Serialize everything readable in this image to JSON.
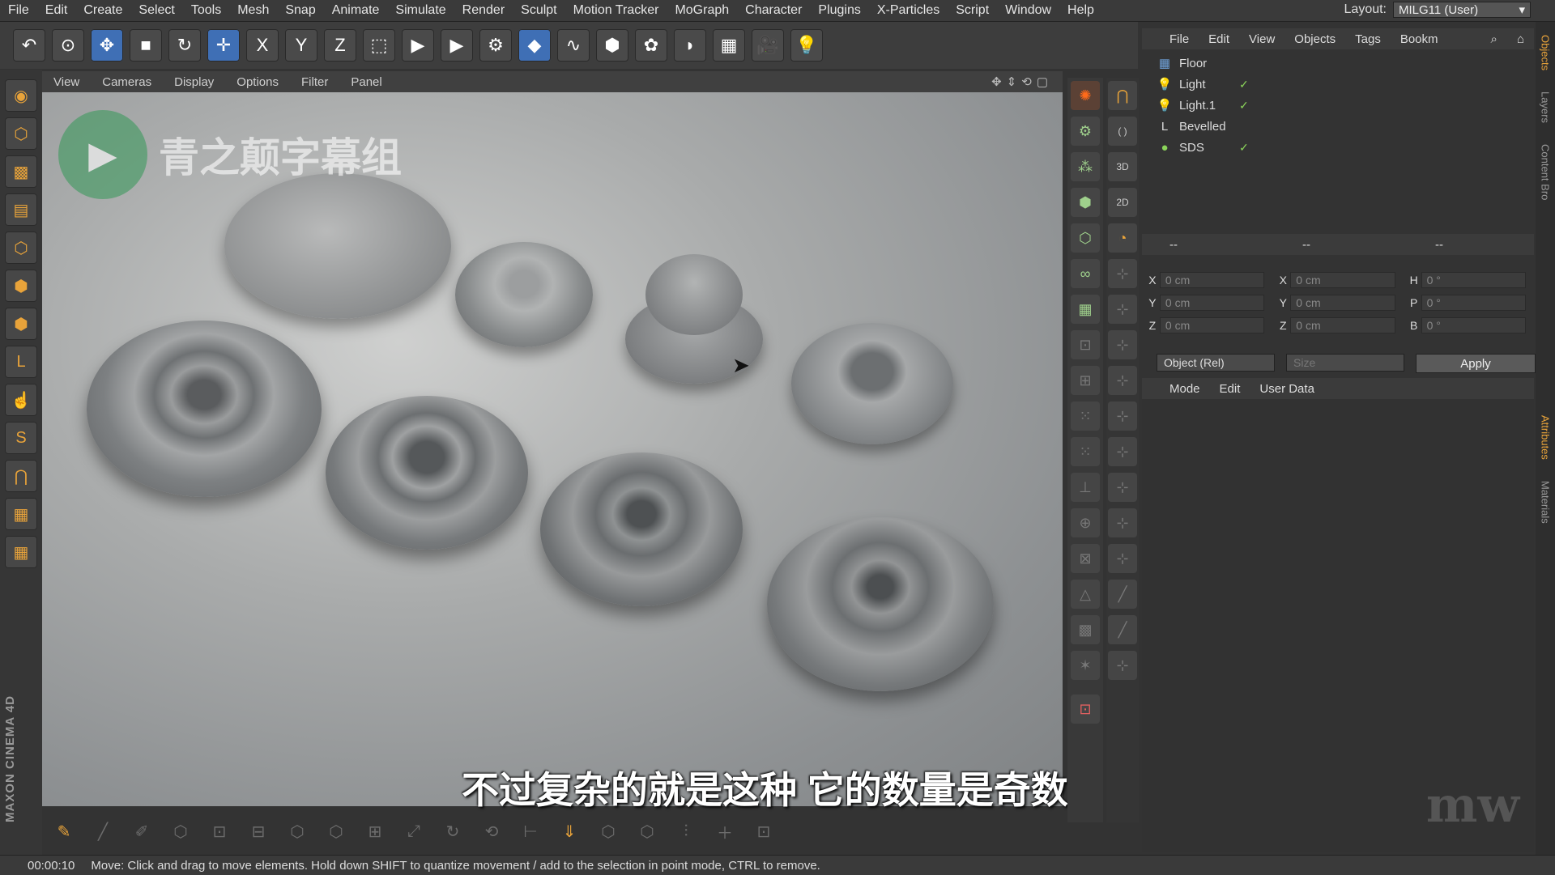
{
  "menu": [
    "File",
    "Edit",
    "Create",
    "Select",
    "Tools",
    "Mesh",
    "Snap",
    "Animate",
    "Simulate",
    "Render",
    "Sculpt",
    "Motion Tracker",
    "MoGraph",
    "Character",
    "Plugins",
    "X-Particles",
    "Script",
    "Window",
    "Help"
  ],
  "layout": {
    "label": "Layout:",
    "value": "MILG11 (User)"
  },
  "viewport": {
    "menu": [
      "View",
      "Cameras",
      "Display",
      "Options",
      "Filter",
      "Panel"
    ]
  },
  "watermark": {
    "text": "青之颠字幕组"
  },
  "subtitle": "不过复杂的就是这种 它的数量是奇数",
  "objects_panel": {
    "menu": [
      "File",
      "Edit",
      "View",
      "Objects",
      "Tags",
      "Bookm"
    ],
    "items": [
      {
        "name": "Floor",
        "icon": "floor-icon"
      },
      {
        "name": "Light",
        "icon": "light-icon"
      },
      {
        "name": "Light.1",
        "icon": "light-icon"
      },
      {
        "name": "Bevelled",
        "icon": "null-icon"
      },
      {
        "name": "SDS",
        "icon": "subdivision-icon"
      }
    ]
  },
  "coords": {
    "header": [
      "--",
      "--",
      "--"
    ],
    "rows": [
      {
        "a": "X",
        "av": "0 cm",
        "b": "X",
        "bv": "0 cm",
        "c": "H",
        "cv": "0 °"
      },
      {
        "a": "Y",
        "av": "0 cm",
        "b": "Y",
        "bv": "0 cm",
        "c": "P",
        "cv": "0 °"
      },
      {
        "a": "Z",
        "av": "0 cm",
        "b": "Z",
        "bv": "0 cm",
        "c": "B",
        "cv": "0 °"
      }
    ],
    "mode_select": "Object (Rel)",
    "size_select": "Size",
    "apply": "Apply"
  },
  "attributes": {
    "menu": [
      "Mode",
      "Edit",
      "User Data"
    ]
  },
  "side_tabs": [
    "Objects",
    "Layers",
    "Content Bro",
    "Attributes",
    "Materials"
  ],
  "left_brand": "MAXON CINEMA 4D",
  "status": {
    "time": "00:00:10",
    "message": "Move: Click and drag to move elements. Hold down SHIFT to quantize movement / add to the selection in point mode, CTRL to remove."
  },
  "icons": {
    "play": "▶",
    "light": "💡"
  }
}
